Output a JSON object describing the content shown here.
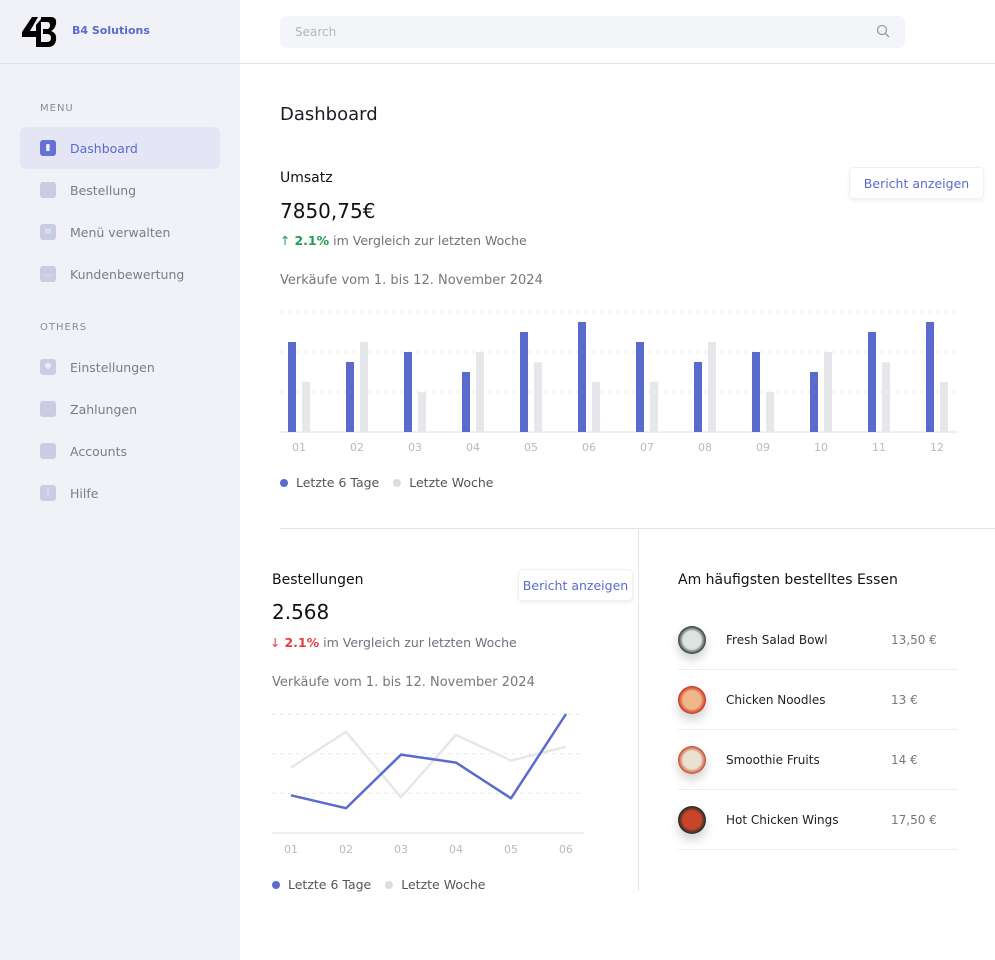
{
  "brand": "B4 Solutions",
  "search": {
    "placeholder": "Search"
  },
  "sidebar": {
    "menu_label": "MENU",
    "menu": [
      {
        "label": "Dashboard",
        "icon": "bar-chart-icon",
        "active": true
      },
      {
        "label": "Bestellung",
        "icon": "cart-icon"
      },
      {
        "label": "Menü verwalten",
        "icon": "document-icon"
      },
      {
        "label": "Kundenbewertung",
        "icon": "chat-icon"
      }
    ],
    "others_label": "OTHERS",
    "others": [
      {
        "label": "Einstellungen",
        "icon": "gear-icon"
      },
      {
        "label": "Zahlungen",
        "icon": "wallet-icon"
      },
      {
        "label": "Accounts",
        "icon": "user-icon"
      },
      {
        "label": "Hilfe",
        "icon": "info-icon"
      }
    ]
  },
  "page_title": "Dashboard",
  "umsatz": {
    "title": "Umsatz",
    "value": "7850,75€",
    "change": "2.1%",
    "change_dir": "up",
    "compare": "im Vergleich zur letzten Woche",
    "button": "Bericht anzeigen",
    "subtitle": "Verkäufe vom 1. bis 12. November 2024"
  },
  "bestellungen": {
    "title": "Bestellungen",
    "value": "2.568",
    "change": "2.1%",
    "change_dir": "down",
    "compare": "im Vergleich zur letzten Woche",
    "button": "Bericht anzeigen",
    "subtitle": "Verkäufe vom 1. bis 12. November 2024"
  },
  "colors": {
    "accent": "#5b6acd",
    "secondary": "#e6e7eb",
    "up": "#1f9d55",
    "down": "#e53e3e"
  },
  "chart_data": [
    {
      "type": "bar",
      "categories": [
        "01",
        "02",
        "03",
        "04",
        "05",
        "06",
        "07",
        "08",
        "09",
        "10",
        "11",
        "12"
      ],
      "ylim": [
        0,
        12
      ],
      "grid": true,
      "legend": "bottom-left",
      "series": [
        {
          "name": "Letzte 6 Tage",
          "values": [
            9,
            7,
            8,
            6,
            10,
            11,
            9,
            7,
            8,
            6,
            10,
            11
          ]
        },
        {
          "name": "Letzte Woche",
          "values": [
            5,
            9,
            4,
            8,
            7,
            5,
            5,
            9,
            4,
            8,
            7,
            5
          ]
        }
      ]
    },
    {
      "type": "line",
      "categories": [
        "01",
        "02",
        "03",
        "04",
        "05",
        "06"
      ],
      "ylim": [
        0,
        12
      ],
      "grid": true,
      "legend": "bottom-left",
      "series": [
        {
          "name": "Letzte 6 Tage",
          "values": [
            3.8,
            2.5,
            7.9,
            7.1,
            3.5,
            12
          ]
        },
        {
          "name": "Letzte Woche",
          "values": [
            6.6,
            10.2,
            3.6,
            9.9,
            7.3,
            8.7
          ]
        }
      ]
    }
  ],
  "popular": {
    "title": "Am häufigsten bestelltes Essen",
    "items": [
      {
        "name": "Fresh Salad Bowl",
        "price": "13,50 €"
      },
      {
        "name": "Chicken Noodles",
        "price": "13 €"
      },
      {
        "name": "Smoothie Fruits",
        "price": "14 €"
      },
      {
        "name": "Hot Chicken Wings",
        "price": "17,50 €"
      }
    ]
  }
}
